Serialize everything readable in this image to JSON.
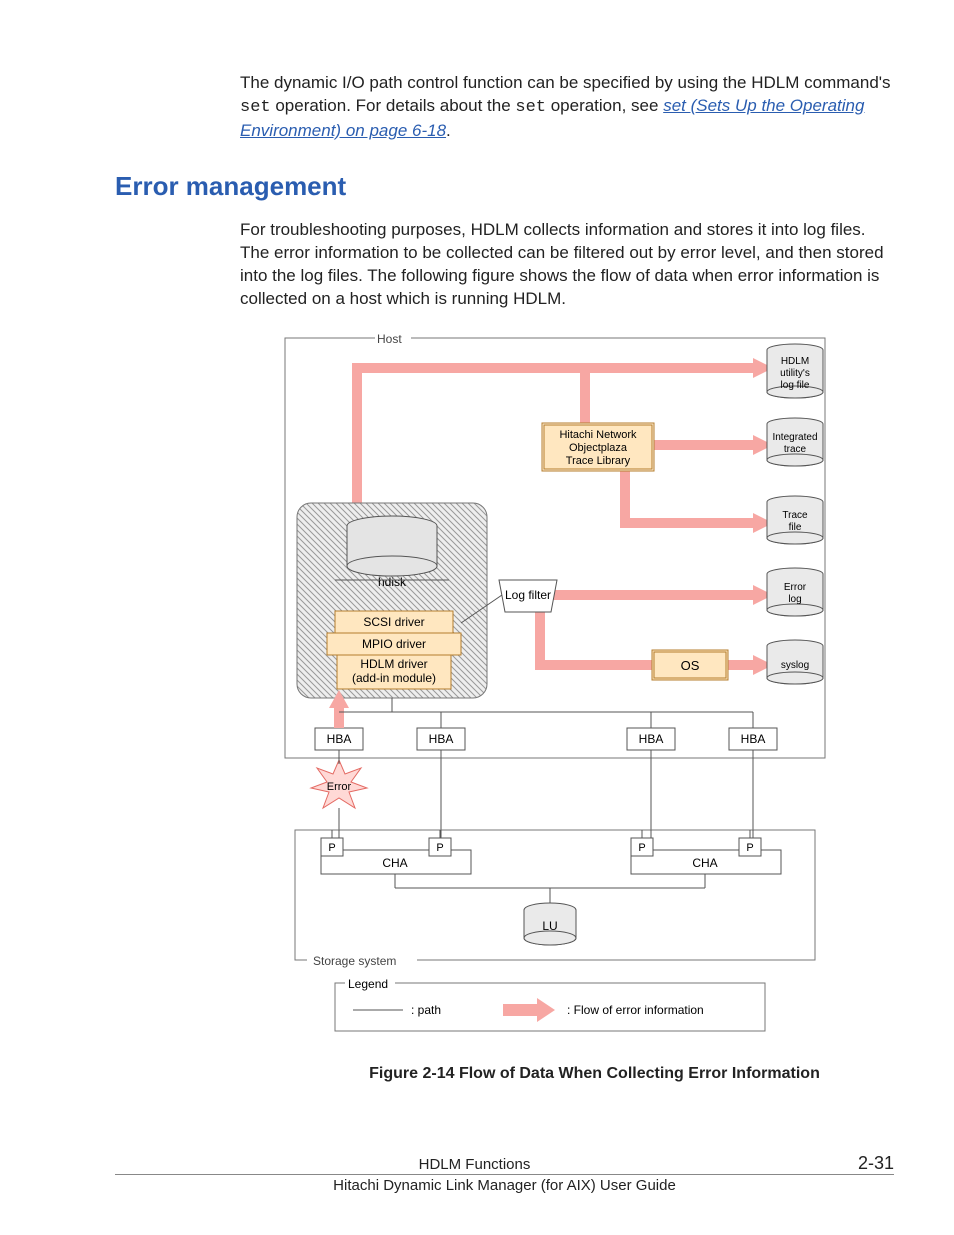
{
  "intro": {
    "part1": "The dynamic I/O path control function can be specified by using the HDLM command's ",
    "code1": "set",
    "part2": " operation. For details about the ",
    "code2": "set",
    "part3": " operation, see ",
    "link": "set (Sets Up the Operating Environment) on page 6-18",
    "part4": "."
  },
  "section_heading": "Error management",
  "section_body": "For troubleshooting purposes, HDLM collects information and stores it into log files. The error information to be collected can be filtered out by error level, and then stored into the log files. The following figure shows the flow of data when error information is collected on a host which is running HDLM.",
  "diagram": {
    "host_label": "Host",
    "hdisk": "hdisk",
    "scsi_driver": "SCSI driver",
    "mpio_driver": "MPIO driver",
    "hdlm_driver1": "HDLM driver",
    "hdlm_driver2": "(add-in module)",
    "hitachi1": "Hitachi Network",
    "hitachi2": "Objectplaza",
    "hitachi3": "Trace Library",
    "log_filter": "Log filter",
    "os": "OS",
    "hdlm_util1": "HDLM",
    "hdlm_util2": "utility's",
    "hdlm_util3": "log file",
    "integrated1": "Integrated",
    "integrated2": "trace",
    "trace1": "Trace",
    "trace2": "file",
    "error1": "Error",
    "error2": "log",
    "syslog": "syslog",
    "hba": "HBA",
    "error_star": "Error",
    "p": "P",
    "cha": "CHA",
    "lu": "LU",
    "storage_system": "Storage system",
    "legend": "Legend",
    "legend_path": ": path",
    "legend_flow": ": Flow of error information"
  },
  "figure_caption": "Figure 2-14 Flow of Data When Collecting Error Information",
  "footer": {
    "center": "HDLM Functions",
    "page": "2-31",
    "sub": "Hitachi Dynamic Link Manager (for AIX) User Guide"
  }
}
